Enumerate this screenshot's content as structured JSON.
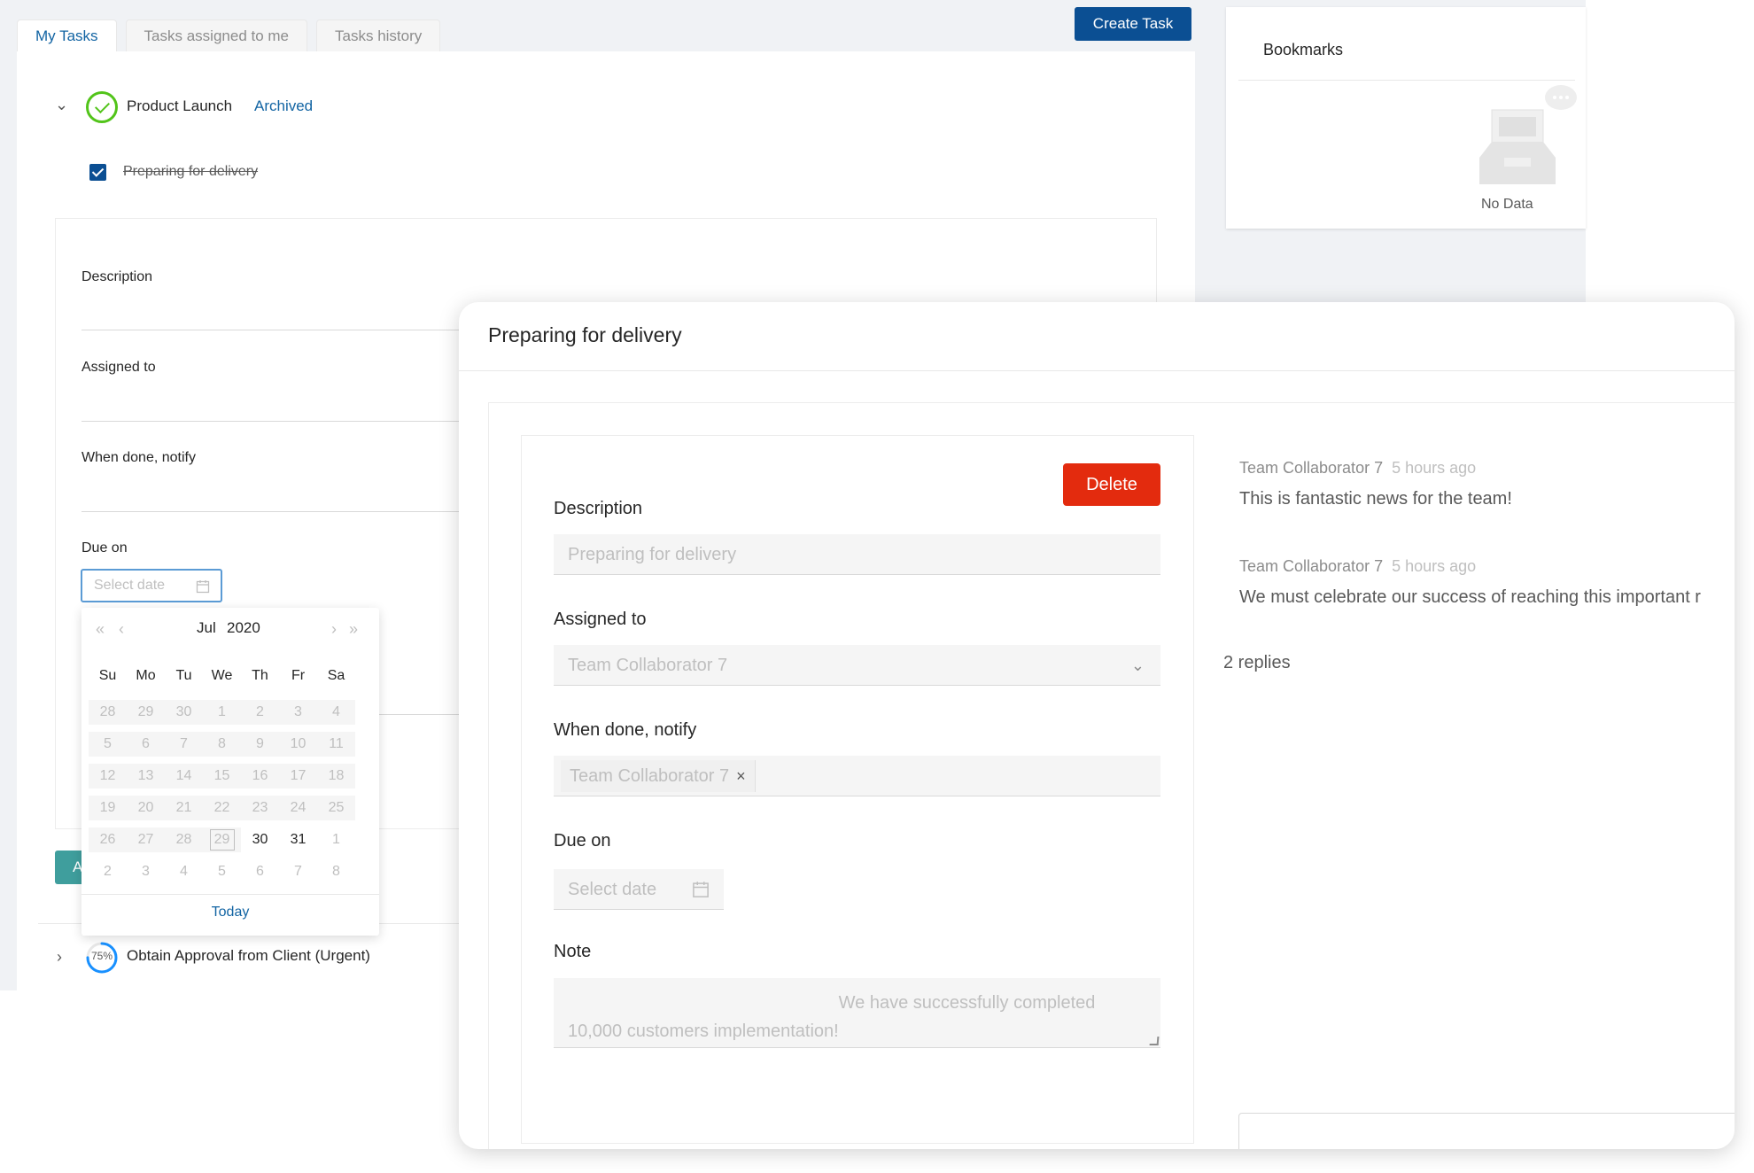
{
  "tabs": [
    {
      "label": "My Tasks",
      "active": true
    },
    {
      "label": "Tasks assigned to me",
      "active": false
    },
    {
      "label": "Tasks history",
      "active": false
    }
  ],
  "create_task_label": "Create Task",
  "project": {
    "title": "Product Launch",
    "status": "Archived"
  },
  "subtask": {
    "title": "Preparing for delivery",
    "done": true
  },
  "background_form": {
    "description_label": "Description",
    "assigned_label": "Assigned to",
    "notify_label": "When done, notify",
    "due_label": "Due on",
    "date_placeholder": "Select date"
  },
  "button_partial_label": "A",
  "datepicker": {
    "month": "Jul",
    "year": "2020",
    "weekdays": [
      "Su",
      "Mo",
      "Tu",
      "We",
      "Th",
      "Fr",
      "Sa"
    ],
    "weeks": [
      [
        "28",
        "29",
        "30",
        "1",
        "2",
        "3",
        "4"
      ],
      [
        "5",
        "6",
        "7",
        "8",
        "9",
        "10",
        "11"
      ],
      [
        "12",
        "13",
        "14",
        "15",
        "16",
        "17",
        "18"
      ],
      [
        "19",
        "20",
        "21",
        "22",
        "23",
        "24",
        "25"
      ],
      [
        "26",
        "27",
        "28",
        "29",
        "30",
        "31",
        "1"
      ],
      [
        "2",
        "3",
        "4",
        "5",
        "6",
        "7",
        "8"
      ]
    ],
    "today_day": "29",
    "today_label": "Today"
  },
  "urgent_task": {
    "title": "Obtain Approval from Client (Urgent)",
    "progress": "75%"
  },
  "bookmarks": {
    "title": "Bookmarks",
    "empty_text": "No Data"
  },
  "modal": {
    "title": "Preparing for delivery",
    "delete_label": "Delete",
    "description_label": "Description",
    "description_placeholder": "Preparing for delivery",
    "assigned_label": "Assigned to",
    "assigned_value": "Team Collaborator 7",
    "notify_label": "When done, notify",
    "notify_tag": "Team Collaborator 7",
    "notify_tag_remove": "×",
    "due_label": "Due on",
    "date_placeholder": "Select date",
    "note_label": "Note",
    "note_text": "                                                       We have successfully completed 10,000 customers implementation!"
  },
  "comments": [
    {
      "author": "Team Collaborator 7",
      "time": "5 hours ago",
      "text": "This is fantastic news for the team!"
    },
    {
      "author": "Team Collaborator 7",
      "time": "5 hours ago",
      "text": "We must celebrate our success of reaching this important r"
    }
  ],
  "replies_label": "2 replies",
  "colors": {
    "primary": "#0b4f93",
    "link": "#1264a3",
    "delete": "#e32b0e",
    "success": "#52c41a",
    "teal": "#3f9e9d"
  }
}
